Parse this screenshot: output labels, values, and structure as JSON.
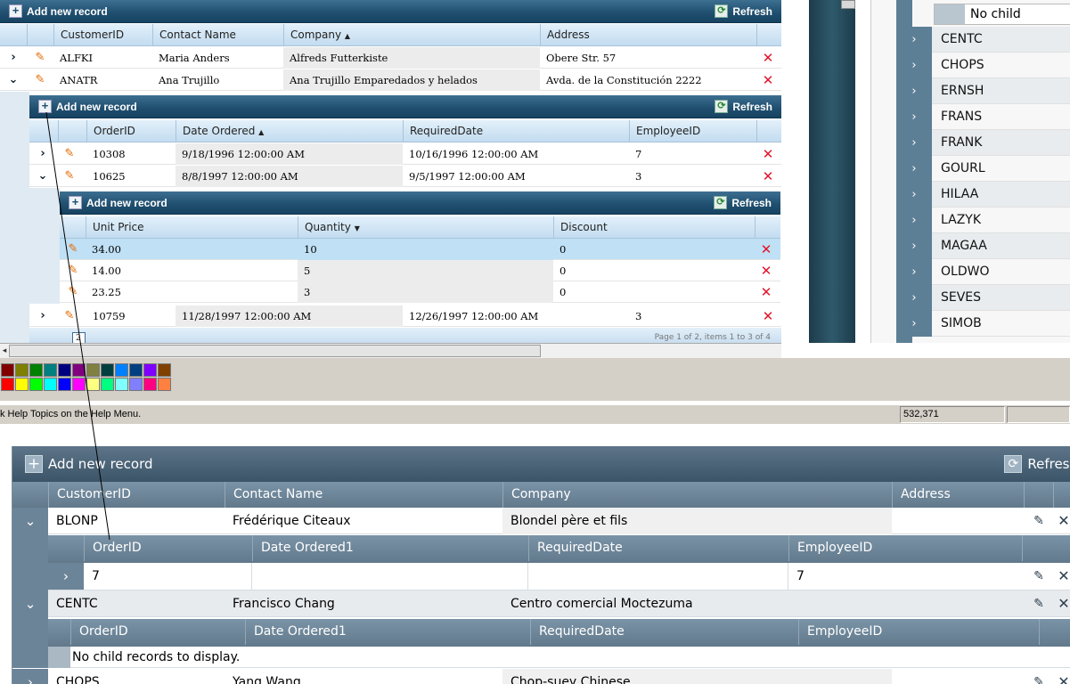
{
  "top_grid": {
    "add_label": "Add new record",
    "refresh_label": "Refresh",
    "columns": [
      "CustomerID",
      "Contact Name",
      "Company",
      "Address"
    ],
    "company_sort_icon": "sort-ascending-icon",
    "rows": [
      {
        "id": "ALFKI",
        "contact": "Maria Anders",
        "company": "Alfreds Futterkiste",
        "address": "Obere Str. 57"
      },
      {
        "id": "ANATR",
        "contact": "Ana Trujillo",
        "company": "Ana Trujillo Emparedados y helados",
        "address": "Avda. de la Constitución 2222"
      }
    ],
    "orders": {
      "add_label": "Add new record",
      "refresh_label": "Refresh",
      "columns": [
        "OrderID",
        "Date Ordered",
        "RequiredDate",
        "EmployeeID"
      ],
      "rows": [
        {
          "id": "10308",
          "date": "9/18/1996 12:00:00 AM",
          "required": "10/16/1996 12:00:00 AM",
          "emp": "7"
        },
        {
          "id": "10625",
          "date": "8/8/1997 12:00:00 AM",
          "required": "9/5/1997 12:00:00 AM",
          "emp": "3"
        }
      ],
      "details": {
        "add_label": "Add new record",
        "refresh_label": "Refresh",
        "columns": [
          "Unit Price",
          "Quantity",
          "Discount"
        ],
        "rows": [
          {
            "price": "34.00",
            "qty": "10",
            "disc": "0"
          },
          {
            "price": "14.00",
            "qty": "5",
            "disc": "0"
          },
          {
            "price": "23.25",
            "qty": "3",
            "disc": "0"
          }
        ]
      },
      "last_row": {
        "id": "10759",
        "date": "11/28/1997 12:00:00 AM",
        "required": "12/26/1997 12:00:00 AM",
        "emp": "3"
      },
      "pager_page": "2",
      "pager_text": "Page 1 of 2, items 1 to 3 of 4"
    }
  },
  "right_panel": {
    "no_child": "No child records",
    "items": [
      "CENTC",
      "CHOPS",
      "ERNSH",
      "FRANS",
      "FRANK",
      "GOURL",
      "HILAA",
      "LAZYK",
      "MAGAA",
      "OLDWO",
      "SEVES",
      "SIMOB"
    ]
  },
  "status_bar": {
    "help_text": "k Help Topics on the Help Menu.",
    "coords": "532,371"
  },
  "palette": [
    "#800000",
    "#808000",
    "#008000",
    "#008080",
    "#000080",
    "#800080",
    "#808040",
    "#004040",
    "#0080ff",
    "#004080",
    "#8000ff",
    "#804000",
    "#ff0000",
    "#ffff00",
    "#00ff00",
    "#00ffff",
    "#0000ff",
    "#ff00ff",
    "#ffff80",
    "#00ff80",
    "#80ffff",
    "#8080ff",
    "#ff0080",
    "#ff8040"
  ],
  "bottom_grid": {
    "add_label": "Add new record",
    "refresh_label": "Refresh",
    "columns": [
      "CustomerID",
      "Contact Name",
      "Company",
      "Address"
    ],
    "row1": {
      "id": "BLONP",
      "contact": "Frédérique Citeaux",
      "company": "Blondel père et fils"
    },
    "child1": {
      "columns": [
        "OrderID",
        "Date Ordered1",
        "RequiredDate",
        "EmployeeID"
      ],
      "row": {
        "id": "7",
        "emp": "7"
      }
    },
    "row2": {
      "id": "CENTC",
      "contact": "Francisco Chang",
      "company": "Centro comercial Moctezuma"
    },
    "child2": {
      "columns": [
        "OrderID",
        "Date Ordered1",
        "RequiredDate",
        "EmployeeID"
      ],
      "empty_text": "No child records to display."
    },
    "row3": {
      "id": "CHOPS",
      "contact": "Yang Wang",
      "company": "Chop-suey Chinese"
    }
  }
}
